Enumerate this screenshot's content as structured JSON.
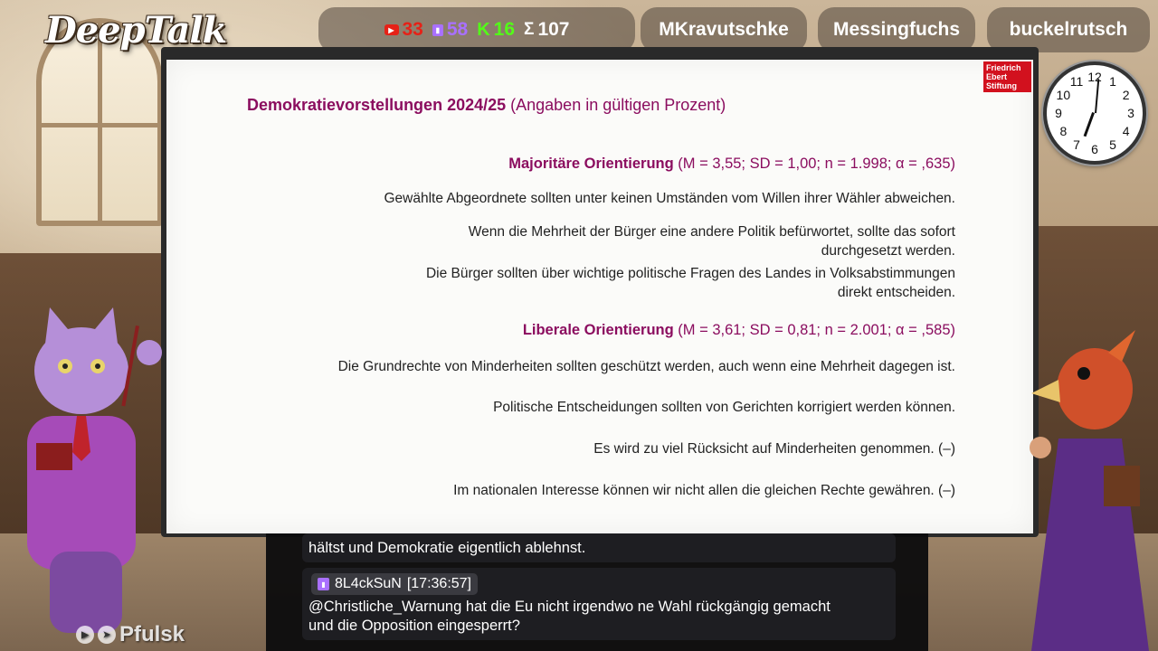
{
  "brand": {
    "logo_text": "DeepTalk"
  },
  "stats": {
    "youtube": {
      "icon": "youtube-icon",
      "value": "33",
      "color": "#e62117"
    },
    "twitch": {
      "icon": "twitch-icon",
      "value": "58",
      "color": "#a970ff"
    },
    "kick": {
      "icon": "kick-icon",
      "label": "K",
      "value": "16",
      "color": "#53fc18"
    },
    "total": {
      "icon": "sum-icon",
      "label": "Σ",
      "value": "107",
      "color": "#ffffff"
    }
  },
  "participants": [
    "MKravutschke",
    "Messingfuchs",
    "buckelrutsch"
  ],
  "slide": {
    "publisher_logo": "Friedrich\nEbert\nStiftung",
    "title_bold": "Demokratievorstellungen 2024/25",
    "title_rest": " (Angaben in gültigen Prozent)",
    "sections": [
      {
        "heading_bold": "Majoritäre Orientierung",
        "heading_stats": " (M = 3,55; SD = 1,00; n = 1.998; α = ,635)",
        "items": [
          "Gewählte Abgeordnete sollten unter keinen Umständen vom Willen ihrer Wähler abweichen.",
          "Wenn die Mehrheit der Bürger eine andere Politik befürwortet, sollte das sofort\ndurchgesetzt werden.",
          "Die Bürger sollten über wichtige politische Fragen des Landes in Volksabstimmungen\ndirekt entscheiden."
        ]
      },
      {
        "heading_bold": "Liberale Orientierung",
        "heading_stats": " (M = 3,61; SD = 0,81; n = 2.001; α = ,585)",
        "items": [
          "Die Grundrechte von Minderheiten sollten geschützt werden, auch wenn eine Mehrheit dagegen ist.",
          "Politische Entscheidungen sollten von Gerichten korrigiert werden können.",
          "Es wird zu viel Rücksicht auf Minderheiten genommen. (–)",
          "Im nationalen Interesse können wir nicht allen die gleichen Rechte gewähren. (–)"
        ]
      }
    ]
  },
  "clock": {
    "numbers": [
      "12",
      "1",
      "2",
      "3",
      "4",
      "5",
      "6",
      "7",
      "8",
      "9",
      "10",
      "11"
    ],
    "hour_angle_deg": 200,
    "minute_angle_deg": 5
  },
  "chat": {
    "prev_message_tail": "hältst und Demokratie eigentlich ablehnst.",
    "messages": [
      {
        "platform_icon": "twitch-icon",
        "user": "8L4ckSuN",
        "time": "[17:36:57]",
        "text": "@Christliche_Warnung hat die Eu nicht irgendwo ne Wahl rückgängig gemacht\nund die Opposition eingesperrt?"
      }
    ]
  },
  "watermark": {
    "text": "Pfulsk",
    "icons": [
      "play-icon",
      "send-icon"
    ]
  }
}
